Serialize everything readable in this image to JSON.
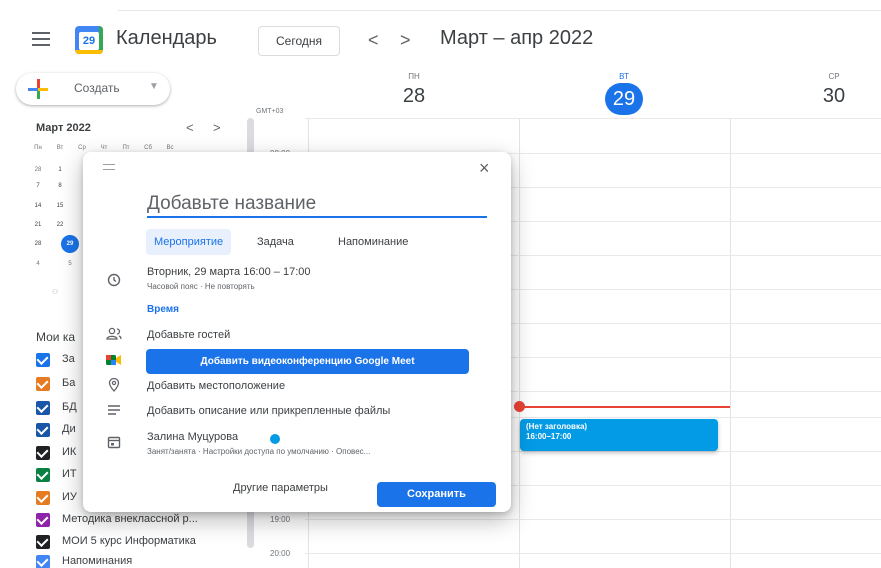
{
  "header": {
    "logo_day": "29",
    "title": "Календарь",
    "today_label": "Сегодня",
    "prev_arrow": "<",
    "next_arrow": ">",
    "date_range": "Март – апр 2022"
  },
  "sidebar": {
    "create_label": "Создать",
    "mini_calendar": {
      "month": "Март 2022",
      "prev": "<",
      "next": ">",
      "weekdays": [
        "Пн",
        "Вт",
        "Ср",
        "Чт",
        "Пт",
        "Сб",
        "Вс"
      ],
      "rows": [
        [
          "28",
          "1"
        ],
        [
          "7",
          "8"
        ],
        [
          "14",
          "15"
        ],
        [
          "21",
          "22"
        ],
        [
          "28",
          "29"
        ],
        [
          "4",
          "5"
        ]
      ],
      "selected": "29"
    },
    "my_calendars_heading": "Мои ка",
    "calendars": [
      {
        "label": "За",
        "color": "#1a73e8"
      },
      {
        "label": "Ба",
        "color": "#e67c22"
      },
      {
        "label": "БД",
        "color": "#1a56a8"
      },
      {
        "label": "Ди",
        "color": "#1a56a8"
      },
      {
        "label": "ИК",
        "color": "#202124"
      },
      {
        "label": "ИТ",
        "color": "#0b8043"
      },
      {
        "label": "ИУ",
        "color": "#e67c22"
      },
      {
        "label": "Методика внеклассной р...",
        "color": "#8e24aa"
      },
      {
        "label": "МОИ 5 курс Информатика",
        "color": "#202124"
      },
      {
        "label": "Напоминания",
        "color": "#4285f4"
      }
    ]
  },
  "grid": {
    "timezone": "GMT+03",
    "days": [
      {
        "dow": "ПН",
        "dom": "28"
      },
      {
        "dow": "ВТ",
        "dom": "29",
        "today": true
      },
      {
        "dow": "СР",
        "dom": "30"
      }
    ],
    "time_labels": [
      "08:00",
      "19:00",
      "20:00"
    ],
    "event": {
      "title": "(Нет заголовка)",
      "time": "16:00–17:00",
      "color": "#039be5"
    }
  },
  "dialog": {
    "title_placeholder": "Добавьте название",
    "tabs": [
      "Мероприятие",
      "Задача",
      "Напоминание"
    ],
    "date_line": "Вторник, 29 марта   16:00  –  17:00",
    "date_sub": "Часовой пояс · Не повторять",
    "time_link": "Время",
    "add_guests": "Добавьте гостей",
    "meet_button": "Добавить видеоконференцию Google Meet",
    "add_location": "Добавить местоположение",
    "add_description": "Добавить описание или прикрепленные файлы",
    "owner_name": "Залина Муцурова",
    "owner_sub": "Занят/занята · Настройки доступа по умолчанию · Оповес...",
    "more_options": "Другие параметры",
    "save": "Сохранить",
    "close": "×"
  },
  "colors": {
    "accent": "#1a73e8",
    "now_line": "#ea4335"
  }
}
